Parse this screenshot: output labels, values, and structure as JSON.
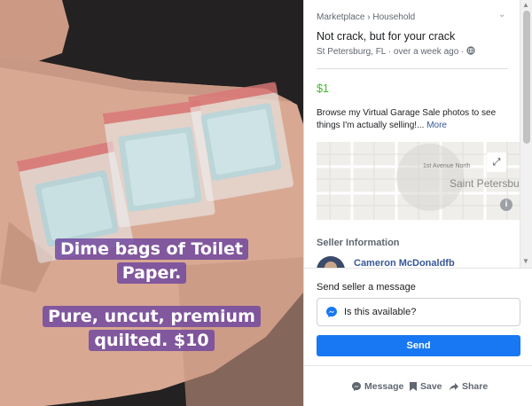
{
  "photo": {
    "caption_line1": "Dime bags of Toilet",
    "caption_line2": "Paper.",
    "caption_line3": "Pure, uncut, premium",
    "caption_line4": "quilted. $10"
  },
  "listing": {
    "breadcrumb": "Marketplace › Household",
    "title": "Not crack, but for your crack",
    "location": "St Petersburg, FL · over a week ago ·",
    "price": "$1",
    "description": "Browse my Virtual Garage Sale photos to see things I'm actually selling!...",
    "more_link": "More",
    "price_color": "#42b72a"
  },
  "map": {
    "street_label": "1st Avenue North",
    "city_label": "Saint Petersbu",
    "expand_icon": "expand-icon",
    "info_icon": "info-icon"
  },
  "seller": {
    "heading": "Seller Information",
    "name": "Cameron McDonaldfb"
  },
  "messaging": {
    "label": "Send seller a message",
    "input_value": "Is this available?",
    "send_label": "Send",
    "accent": "#1877f2"
  },
  "actions": {
    "message": "Message",
    "save": "Save",
    "share": "Share"
  }
}
